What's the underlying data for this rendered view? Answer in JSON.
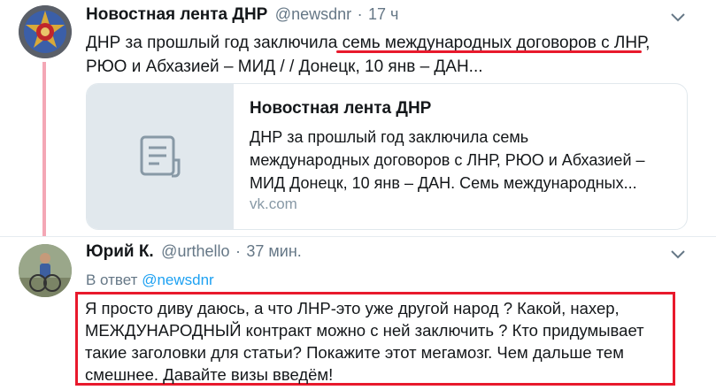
{
  "tweet1": {
    "display_name": "Новостная лента ДНР",
    "handle": "@newsdnr",
    "separator": "·",
    "time": "17 ч",
    "text_line1_a": "ДНР за прошлый год заключила ",
    "text_line1_b": "семь международных договоров с ЛНР,",
    "text_line2": "РЮО и Абхазией – МИД /  / Донецк, 10 янв – ДАН...",
    "avatar_icon": "emblem-icon",
    "card": {
      "title": "Новостная лента ДНР",
      "description_line1": "ДНР за прошлый год заключила семь",
      "description_line2": "международных договоров с ЛНР, РЮО и Абхазией –",
      "description_line3": "МИД Донецк, 10 янв – ДАН. Семь международных...",
      "domain": "vk.com",
      "icon": "document-icon"
    }
  },
  "tweet2": {
    "display_name": "Юрий К.",
    "handle": "@urthello",
    "separator": "·",
    "time": "37 мин.",
    "reply_prefix": "В ответ",
    "reply_mention": "@newsdnr",
    "text_line1": "Я просто диву даюсь, а что ЛНР-это уже другой народ ? Какой, нахер,",
    "text_line2": "МЕЖДУНАРОДНЫЙ контракт можно с ней заключить ? Кто придумывает",
    "text_line3": "такие заголовки для статьи? Покажите этот мегамозг. Чем  дальше тем",
    "text_line4": "смешнее. Давайте визы введём!"
  },
  "colors": {
    "highlight_red": "#e8192c",
    "thread_line": "#f4a7b5",
    "link_blue": "#1da1f2",
    "secondary_text": "#657786"
  }
}
